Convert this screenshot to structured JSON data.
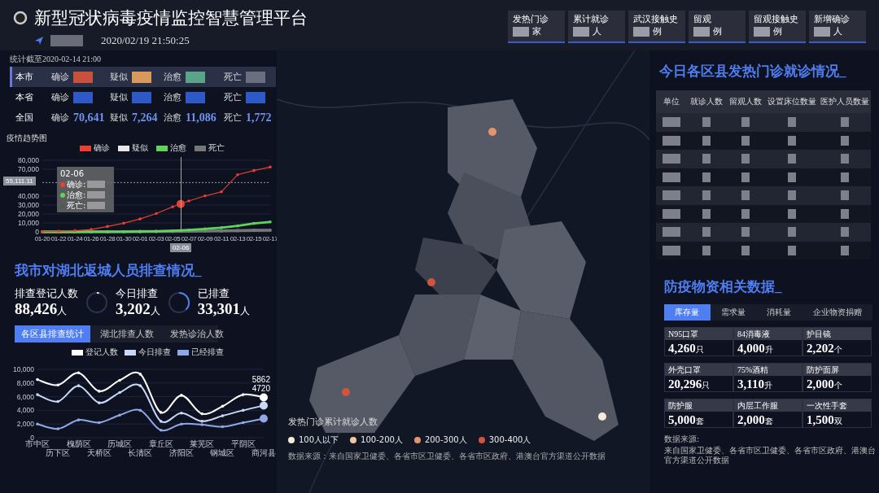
{
  "header": {
    "title": "新型冠状病毒疫情监控智慧管理平台",
    "datetime": "2020/02/19 21:50:25"
  },
  "top_cards": [
    {
      "label": "发热门诊",
      "unit": "家"
    },
    {
      "label": "累计就诊",
      "unit": "人"
    },
    {
      "label": "武汉接触史",
      "unit": "例"
    },
    {
      "label": "留观",
      "unit": "例"
    },
    {
      "label": "留观接触史",
      "unit": "例"
    },
    {
      "label": "新增确诊",
      "unit": "人"
    }
  ],
  "overview": {
    "as_of": "统计截至2020-02-14  21:00",
    "rows": [
      {
        "scope": "本市",
        "selected": true,
        "items": [
          {
            "label": "确诊",
            "color": "#c9503c"
          },
          {
            "label": "疑似",
            "color": "#d89a5c"
          },
          {
            "label": "治愈",
            "color": "#5aa48a"
          },
          {
            "label": "死亡",
            "color": "#6a6f80"
          }
        ]
      },
      {
        "scope": "本省",
        "selected": false,
        "items": [
          {
            "label": "确诊",
            "color": "#2f58c8"
          },
          {
            "label": "疑似",
            "color": "#2f58c8"
          },
          {
            "label": "治愈",
            "color": "#2f58c8"
          },
          {
            "label": "死亡",
            "color": "#2f58c8"
          }
        ]
      },
      {
        "scope": "全国",
        "selected": false,
        "items": [
          {
            "label": "确诊",
            "value": "70,641"
          },
          {
            "label": "疑似",
            "value": "7,264"
          },
          {
            "label": "治愈",
            "value": "11,086"
          },
          {
            "label": "死亡",
            "value": "1,772"
          }
        ]
      }
    ]
  },
  "trend": {
    "title": "疫情趋势图",
    "pointer_date": "02-06",
    "tooltip": {
      "date": "02-06",
      "items": [
        {
          "label": "确诊:",
          "color": "#e8412f"
        },
        {
          "label": "治愈:",
          "color": "#5fd35a"
        },
        {
          "label": "死亡:",
          "color": "#555555"
        }
      ]
    },
    "chart_data": {
      "type": "line",
      "grid": true,
      "categories": [
        "01-20",
        "01-22",
        "01-24",
        "01-26",
        "01-28",
        "01-30",
        "02-01",
        "02-03",
        "02-05",
        "02-07",
        "02-09",
        "02-11",
        "02-13",
        "02-15",
        "02-17"
      ],
      "series": [
        {
          "name": "确诊",
          "color": "#e8412f",
          "values": [
            300,
            600,
            1300,
            2700,
            6000,
            9700,
            14400,
            20400,
            28000,
            34500,
            40200,
            44700,
            63900,
            68500,
            72400
          ]
        },
        {
          "name": "疑似",
          "color": "#e8e8e8",
          "values": [
            null,
            null,
            null,
            null,
            null,
            null,
            null,
            null,
            null,
            null,
            null,
            null,
            null,
            null,
            null
          ]
        },
        {
          "name": "治愈",
          "color": "#5fd35a",
          "values": [
            0,
            0,
            0,
            100,
            100,
            200,
            300,
            600,
            1200,
            2100,
            3300,
            4700,
            6700,
            9400,
            11100
          ]
        },
        {
          "name": "死亡",
          "color": "#777777",
          "values": [
            0,
            0,
            0,
            100,
            100,
            200,
            300,
            400,
            600,
            700,
            900,
            1100,
            1400,
            1700,
            1800
          ]
        }
      ],
      "ylim": [
        0,
        80000
      ],
      "yticks": [
        {
          "value": 0,
          "label": "0"
        },
        {
          "value": 10000,
          "label": "10,000"
        },
        {
          "value": 20000,
          "label": "20,000"
        },
        {
          "value": 30000,
          "label": "30,000"
        },
        {
          "value": 40000,
          "label": "40,000"
        },
        {
          "value": 70000,
          "label": "70,000"
        },
        {
          "value": 80000,
          "label": "80,000"
        }
      ],
      "ref_lines": [
        {
          "axis": "y",
          "value": 55111.11,
          "label": "55,111.11"
        }
      ]
    }
  },
  "survey": {
    "title": "我市对湖北返城人员排查情况_",
    "stats": [
      {
        "label": "排查登记人数",
        "value": "88,426",
        "unit": "人"
      },
      {
        "label": "今日排查",
        "value": "3,202",
        "unit": "人",
        "kind": "ring"
      },
      {
        "label": "已排查",
        "value": "33,301",
        "unit": "人",
        "kind": "ring"
      }
    ],
    "tabs": [
      {
        "label": "各区县排查统计",
        "selected": true
      },
      {
        "label": "湖北排查人数",
        "selected": false
      },
      {
        "label": "发热诊治人数",
        "selected": false
      }
    ],
    "chart_data": {
      "type": "line",
      "grid": true,
      "categories": [
        "市中区",
        "历下区",
        "槐荫区",
        "天桥区",
        "历城区",
        "长清区",
        "章丘区",
        "济阳区",
        "莱芜区",
        "钢城区",
        "平阴区",
        "商河县"
      ],
      "series": [
        {
          "name": "登记人数",
          "color": "#ffffff",
          "values": [
            8500,
            7700,
            9500,
            6800,
            8400,
            9300,
            3700,
            6200,
            3500,
            4600,
            6300,
            5900
          ]
        },
        {
          "name": "今日排查",
          "color": "#c8d8f8",
          "values": [
            6300,
            5300,
            7600,
            5100,
            6600,
            7600,
            2400,
            3600,
            2400,
            3200,
            4000,
            4700
          ]
        },
        {
          "name": "已经排查",
          "color": "#8fa8e8",
          "values": [
            2000,
            1300,
            2600,
            2200,
            3300,
            4000,
            1100,
            2000,
            1900,
            1600,
            2200,
            2800
          ]
        }
      ],
      "ylim": [
        0,
        10000
      ],
      "yticks": [
        {
          "value": 0,
          "label": "0"
        },
        {
          "value": 2000,
          "label": "2,000"
        },
        {
          "value": 4000,
          "label": "4,000"
        },
        {
          "value": 6000,
          "label": "6,000"
        },
        {
          "value": 8000,
          "label": "8,000"
        },
        {
          "value": 10000,
          "label": "10,000"
        }
      ],
      "annotations": [
        {
          "x": "商河县",
          "y": 5900,
          "text": "5862"
        },
        {
          "x": "商河县",
          "y": 4700,
          "text": "4720"
        }
      ]
    }
  },
  "fever_clinics": {
    "title": "今日各区县发热门诊就诊情况_",
    "columns": [
      "单位",
      "就诊人数",
      "留观人数",
      "设置床位数量",
      "医护人员数量"
    ]
  },
  "supplies": {
    "title": "防疫物资相关数据_",
    "tabs": [
      {
        "label": "库存量",
        "selected": true
      },
      {
        "label": "需求量",
        "selected": false
      },
      {
        "label": "消耗量",
        "selected": false
      },
      {
        "label": "企业物资捐赠",
        "selected": false
      }
    ],
    "items": [
      {
        "label": "N95口罩",
        "value": "4,260",
        "unit": "只"
      },
      {
        "label": "84消毒液",
        "value": "4,000",
        "unit": "升"
      },
      {
        "label": "护目镜",
        "value": "2,202",
        "unit": "个"
      },
      {
        "label": "外壳口罩",
        "value": "20,296",
        "unit": "只"
      },
      {
        "label": "75%酒精",
        "value": "3,110",
        "unit": "升"
      },
      {
        "label": "防护面屏",
        "value": "2,000",
        "unit": "个"
      },
      {
        "label": "防护服",
        "value": "5,000",
        "unit": "套"
      },
      {
        "label": "内层工作服",
        "value": "2,000",
        "unit": "套"
      },
      {
        "label": "一次性手套",
        "value": "1,500",
        "unit": "双"
      }
    ],
    "source_label": "数据来源:",
    "source": "来自国家卫健委、各省市区卫健委、各省市区政府、港澳台官方渠道公开数据"
  },
  "map_legend": {
    "title": "发热门诊累计就诊人数",
    "items": [
      {
        "label": "100人以下",
        "color": "#f7ead8"
      },
      {
        "label": "100-200人",
        "color": "#f3c6a0"
      },
      {
        "label": "200-300人",
        "color": "#e8946a"
      },
      {
        "label": "300-400人",
        "color": "#d0543e"
      }
    ],
    "source": "数据来源：来自国家卫健委、各省市区卫健委、各省市区政府、港澳台官方渠道公开数据"
  }
}
